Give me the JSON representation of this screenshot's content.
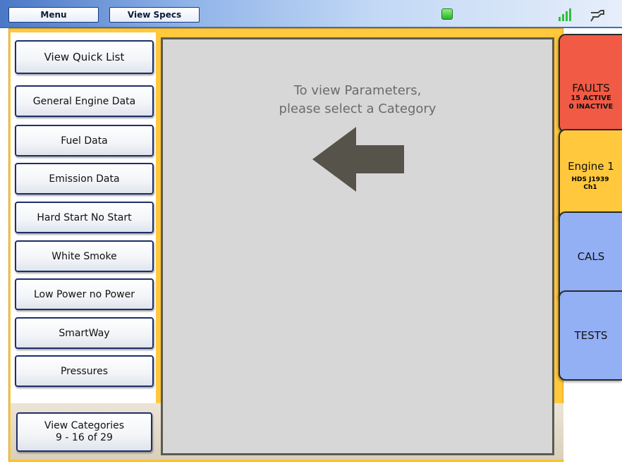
{
  "topbar": {
    "menu_label": "Menu",
    "view_specs_label": "View Specs"
  },
  "content": {
    "instruction_line1": "To view Parameters,",
    "instruction_line2": "please select a Category"
  },
  "categories": [
    "View Quick List",
    "General Engine Data",
    "Fuel Data",
    "Emission Data",
    "Hard Start No Start",
    "White Smoke",
    "Low Power no Power",
    "SmartWay",
    "Pressures"
  ],
  "view_categories": {
    "line1": "View Categories",
    "line2": "9 - 16 of 29"
  },
  "tabs": {
    "faults": {
      "title": "FAULTS",
      "line1": "15 ACTIVE",
      "line2": "0 INACTIVE"
    },
    "engine": {
      "title": "Engine 1",
      "line1": "HDS J1939",
      "line2": "Ch1"
    },
    "cals": {
      "title": "CALS"
    },
    "tests": {
      "title": "TESTS"
    }
  },
  "colors": {
    "faults_tab": "#f15a45",
    "engine_tab": "#ffc83d",
    "cals_tab": "#93b0f5",
    "tests_tab": "#93b0f5",
    "frame": "#ffc83d",
    "content_bg": "#d7d7d7",
    "arrow": "#55534a"
  },
  "icons": {
    "status_indicator": "green-status-icon",
    "signal": "signal-strength-icon",
    "connection": "connector-plug-icon",
    "instruction_arrow": "left-arrow-icon"
  }
}
